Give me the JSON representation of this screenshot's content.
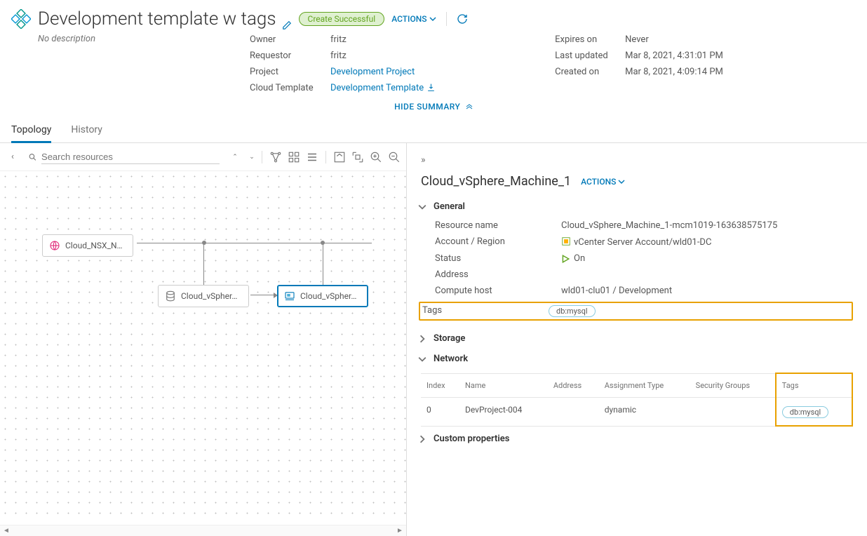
{
  "header": {
    "title": "Development template w tags",
    "status": "Create Successful",
    "actions_label": "ACTIONS",
    "no_description": "No description"
  },
  "summary": {
    "owner_label": "Owner",
    "owner": "fritz",
    "requestor_label": "Requestor",
    "requestor": "fritz",
    "project_label": "Project",
    "project": "Development Project",
    "template_label": "Cloud Template",
    "template": "Development Template",
    "expires_label": "Expires on",
    "expires": "Never",
    "updated_label": "Last updated",
    "updated": "Mar 8, 2021, 4:31:01 PM",
    "created_label": "Created on",
    "created": "Mar 8, 2021, 4:09:14 PM",
    "hide_label": "HIDE SUMMARY"
  },
  "tabs": {
    "topology": "Topology",
    "history": "History"
  },
  "canvas": {
    "search_placeholder": "Search resources",
    "nodes": {
      "nsx": "Cloud_NSX_N…",
      "db": "Cloud_vSpher…",
      "vm": "Cloud_vSpher…"
    }
  },
  "details": {
    "title": "Cloud_vSphere_Machine_1",
    "actions_label": "ACTIONS",
    "sections": {
      "general": "General",
      "storage": "Storage",
      "network": "Network",
      "custom": "Custom properties"
    },
    "general": {
      "resource_name_label": "Resource name",
      "resource_name": "Cloud_vSphere_Machine_1-mcm1019-163638575175",
      "account_label": "Account / Region",
      "account": "vCenter Server Account/wld01-DC",
      "status_label": "Status",
      "status": "On",
      "address_label": "Address",
      "compute_label": "Compute host",
      "compute": "wld01-clu01 / Development",
      "tags_label": "Tags",
      "tag": "db:mysql"
    },
    "network": {
      "cols": {
        "index": "Index",
        "name": "Name",
        "address": "Address",
        "assignment": "Assignment Type",
        "security": "Security Groups",
        "tags": "Tags"
      },
      "rows": [
        {
          "index": "0",
          "name": "DevProject-004",
          "address": "",
          "assignment": "dynamic",
          "security": "",
          "tag": "db:mysql"
        }
      ]
    }
  }
}
